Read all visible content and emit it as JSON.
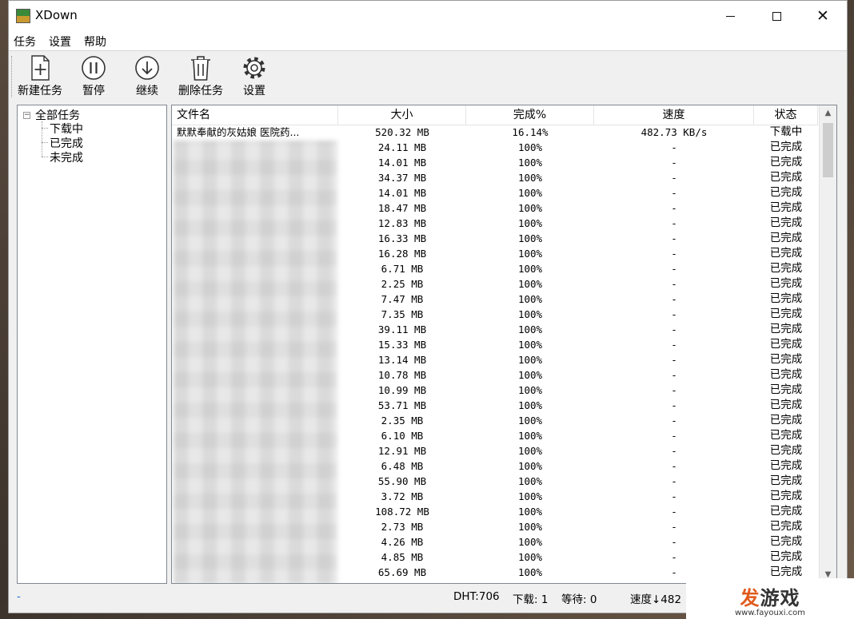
{
  "window": {
    "title": "XDown"
  },
  "menu": [
    "任务",
    "设置",
    "帮助"
  ],
  "toolbar": [
    {
      "label": "新建任务",
      "icon": "new-task-icon"
    },
    {
      "label": "暂停",
      "icon": "pause-icon"
    },
    {
      "label": "继续",
      "icon": "resume-icon"
    },
    {
      "label": "删除任务",
      "icon": "delete-icon"
    },
    {
      "label": "设置",
      "icon": "gear-icon"
    }
  ],
  "tree": {
    "root": "全部任务",
    "root_expander": "−",
    "children": [
      "下载中",
      "已完成",
      "未完成"
    ]
  },
  "list": {
    "columns": [
      "文件名",
      "大小",
      "完成%",
      "速度",
      "状态"
    ],
    "rows": [
      {
        "name": "默默奉献的灰姑娘 医院药...",
        "size": "520.32 MB",
        "pct": "16.14%",
        "speed": "482.73 KB/s",
        "status": "下载中"
      },
      {
        "name": "",
        "size": "24.11 MB",
        "pct": "100%",
        "speed": "-",
        "status": "已完成"
      },
      {
        "name": "",
        "size": "14.01 MB",
        "pct": "100%",
        "speed": "-",
        "status": "已完成"
      },
      {
        "name": "",
        "size": "34.37 MB",
        "pct": "100%",
        "speed": "-",
        "status": "已完成"
      },
      {
        "name": "",
        "size": "14.01 MB",
        "pct": "100%",
        "speed": "-",
        "status": "已完成"
      },
      {
        "name": "",
        "size": "18.47 MB",
        "pct": "100%",
        "speed": "-",
        "status": "已完成"
      },
      {
        "name": "",
        "size": "12.83 MB",
        "pct": "100%",
        "speed": "-",
        "status": "已完成"
      },
      {
        "name": "",
        "size": "16.33 MB",
        "pct": "100%",
        "speed": "-",
        "status": "已完成"
      },
      {
        "name": "",
        "size": "16.28 MB",
        "pct": "100%",
        "speed": "-",
        "status": "已完成"
      },
      {
        "name": "",
        "size": "6.71 MB",
        "pct": "100%",
        "speed": "-",
        "status": "已完成"
      },
      {
        "name": "",
        "size": "2.25 MB",
        "pct": "100%",
        "speed": "-",
        "status": "已完成"
      },
      {
        "name": "",
        "size": "7.47 MB",
        "pct": "100%",
        "speed": "-",
        "status": "已完成"
      },
      {
        "name": "",
        "size": "7.35 MB",
        "pct": "100%",
        "speed": "-",
        "status": "已完成"
      },
      {
        "name": "",
        "size": "39.11 MB",
        "pct": "100%",
        "speed": "-",
        "status": "已完成"
      },
      {
        "name": "",
        "size": "15.33 MB",
        "pct": "100%",
        "speed": "-",
        "status": "已完成"
      },
      {
        "name": "",
        "size": "13.14 MB",
        "pct": "100%",
        "speed": "-",
        "status": "已完成"
      },
      {
        "name": "",
        "size": "10.78 MB",
        "pct": "100%",
        "speed": "-",
        "status": "已完成"
      },
      {
        "name": "",
        "size": "10.99 MB",
        "pct": "100%",
        "speed": "-",
        "status": "已完成"
      },
      {
        "name": "",
        "size": "53.71 MB",
        "pct": "100%",
        "speed": "-",
        "status": "已完成"
      },
      {
        "name": "",
        "size": "2.35 MB",
        "pct": "100%",
        "speed": "-",
        "status": "已完成"
      },
      {
        "name": "",
        "size": "6.10 MB",
        "pct": "100%",
        "speed": "-",
        "status": "已完成"
      },
      {
        "name": "",
        "size": "12.91 MB",
        "pct": "100%",
        "speed": "-",
        "status": "已完成"
      },
      {
        "name": "",
        "size": "6.48 MB",
        "pct": "100%",
        "speed": "-",
        "status": "已完成"
      },
      {
        "name": "",
        "size": "55.90 MB",
        "pct": "100%",
        "speed": "-",
        "status": "已完成"
      },
      {
        "name": "",
        "size": "3.72 MB",
        "pct": "100%",
        "speed": "-",
        "status": "已完成"
      },
      {
        "name": "",
        "size": "108.72 MB",
        "pct": "100%",
        "speed": "-",
        "status": "已完成"
      },
      {
        "name": "",
        "size": "2.73 MB",
        "pct": "100%",
        "speed": "-",
        "status": "已完成"
      },
      {
        "name": "",
        "size": "4.26 MB",
        "pct": "100%",
        "speed": "-",
        "status": "已完成"
      },
      {
        "name": "",
        "size": "4.85 MB",
        "pct": "100%",
        "speed": "-",
        "status": "已完成"
      },
      {
        "name": "",
        "size": "65.69 MB",
        "pct": "100%",
        "speed": "-",
        "status": "已完成"
      }
    ]
  },
  "statusbar": {
    "left": "-",
    "dht": "DHT:706",
    "downloading": "下载: 1",
    "waiting": "等待: 0",
    "speed": "速度↓482"
  },
  "watermark": {
    "logo_accent": "发",
    "logo_rest": "游戏",
    "url": "www.fayouxi.com"
  },
  "scroll": {
    "up_arrow": "▲",
    "down_arrow": "▼"
  },
  "colors": {
    "window_bg": "#f0f0f0",
    "list_bg": "#ffffff",
    "watermark_accent": "#e05a1c",
    "status_link": "#1a6ed0"
  }
}
